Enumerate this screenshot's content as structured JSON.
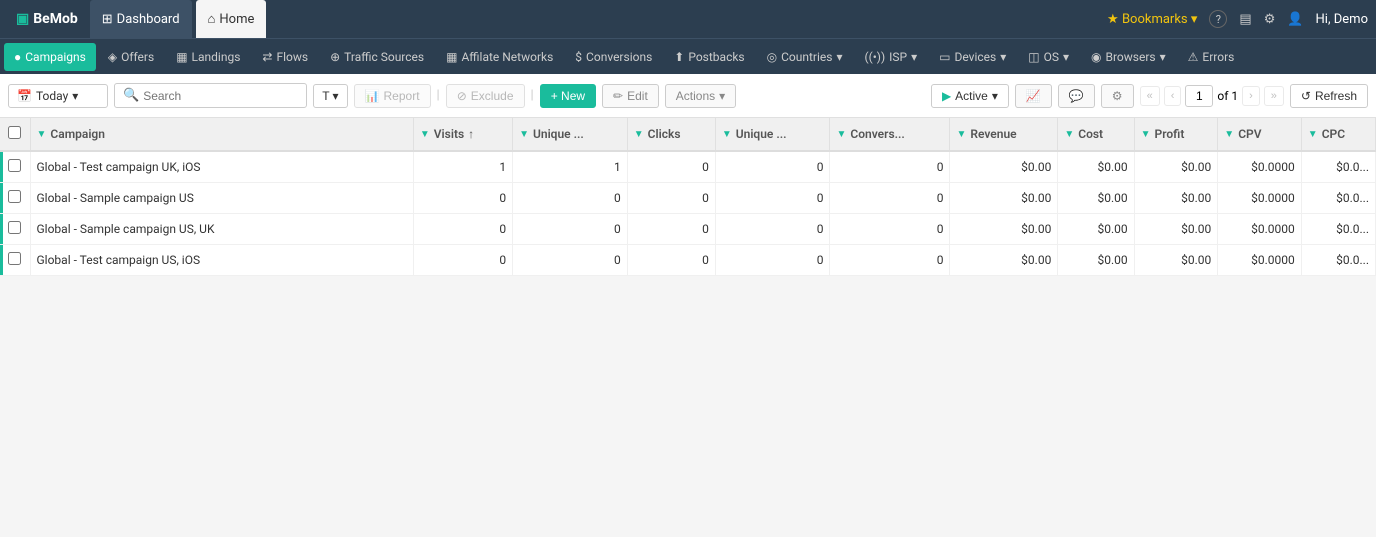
{
  "app": {
    "logo_text": "BeMob",
    "logo_icon": "▣"
  },
  "top_nav": {
    "tabs": [
      {
        "id": "dashboard",
        "label": "Dashboard",
        "icon": "⊞",
        "active": false
      },
      {
        "id": "home",
        "label": "Home",
        "icon": "⌂",
        "active": true
      }
    ],
    "right": {
      "bookmarks_label": "Bookmarks",
      "help_icon": "?",
      "user_greeting": "Hi, Demo"
    }
  },
  "sub_nav": {
    "items": [
      {
        "id": "campaigns",
        "label": "Campaigns",
        "icon": "●",
        "active": true
      },
      {
        "id": "offers",
        "label": "Offers",
        "icon": "◈"
      },
      {
        "id": "landings",
        "label": "Landings",
        "icon": "▦"
      },
      {
        "id": "flows",
        "label": "Flows",
        "icon": "⇄"
      },
      {
        "id": "traffic_sources",
        "label": "Traffic Sources",
        "icon": "⊕"
      },
      {
        "id": "affiliate_networks",
        "label": "Affilate Networks",
        "icon": "▦"
      },
      {
        "id": "conversions",
        "label": "Conversions",
        "icon": "$"
      },
      {
        "id": "postbacks",
        "label": "Postbacks",
        "icon": "⬆"
      },
      {
        "id": "countries",
        "label": "Countries",
        "icon": "◎",
        "has_arrow": true
      },
      {
        "id": "isp",
        "label": "ISP",
        "icon": "((•))",
        "has_arrow": true
      },
      {
        "id": "devices",
        "label": "Devices",
        "icon": "▭",
        "has_arrow": true
      },
      {
        "id": "os",
        "label": "OS",
        "icon": "◫",
        "has_arrow": true
      },
      {
        "id": "browsers",
        "label": "Browsers",
        "icon": "◉",
        "has_arrow": true
      },
      {
        "id": "errors",
        "label": "Errors",
        "icon": "⚠"
      }
    ]
  },
  "toolbar": {
    "date_label": "Today",
    "date_icon": "📅",
    "search_placeholder": "Search",
    "filter_label": "T",
    "report_label": "Report",
    "exclude_label": "Exclude",
    "new_label": "+ New",
    "edit_label": "Edit",
    "actions_label": "Actions",
    "active_label": "Active",
    "pagination": {
      "current_page": "1",
      "total_pages": "of 1"
    },
    "refresh_label": "Refresh"
  },
  "table": {
    "columns": [
      {
        "id": "checkbox",
        "label": ""
      },
      {
        "id": "campaign",
        "label": "Campaign",
        "sortable": true
      },
      {
        "id": "visits",
        "label": "Visits",
        "sortable": true
      },
      {
        "id": "unique_visits",
        "label": "Unique ...",
        "sortable": true
      },
      {
        "id": "clicks",
        "label": "Clicks",
        "sortable": true
      },
      {
        "id": "unique_clicks",
        "label": "Unique ...",
        "sortable": true
      },
      {
        "id": "conversions",
        "label": "Convers...",
        "sortable": true
      },
      {
        "id": "revenue",
        "label": "Revenue",
        "sortable": true
      },
      {
        "id": "cost",
        "label": "Cost",
        "sortable": true
      },
      {
        "id": "profit",
        "label": "Profit",
        "sortable": true
      },
      {
        "id": "cpv",
        "label": "CPV",
        "sortable": true
      },
      {
        "id": "cpc",
        "label": "CPC",
        "sortable": true
      }
    ],
    "rows": [
      {
        "id": 1,
        "campaign": "Global - Test campaign UK, iOS",
        "visits": "1",
        "unique_visits": "1",
        "clicks": "0",
        "unique_clicks": "0",
        "conversions": "0",
        "revenue": "$0.00",
        "cost": "$0.00",
        "profit": "$0.00",
        "cpv": "$0.0000",
        "cpc": "$0.0..."
      },
      {
        "id": 2,
        "campaign": "Global - Sample campaign US",
        "visits": "0",
        "unique_visits": "0",
        "clicks": "0",
        "unique_clicks": "0",
        "conversions": "0",
        "revenue": "$0.00",
        "cost": "$0.00",
        "profit": "$0.00",
        "cpv": "$0.0000",
        "cpc": "$0.0..."
      },
      {
        "id": 3,
        "campaign": "Global - Sample campaign US, UK",
        "visits": "0",
        "unique_visits": "0",
        "clicks": "0",
        "unique_clicks": "0",
        "conversions": "0",
        "revenue": "$0.00",
        "cost": "$0.00",
        "profit": "$0.00",
        "cpv": "$0.0000",
        "cpc": "$0.0..."
      },
      {
        "id": 4,
        "campaign": "Global - Test campaign US, iOS",
        "visits": "0",
        "unique_visits": "0",
        "clicks": "0",
        "unique_clicks": "0",
        "conversions": "0",
        "revenue": "$0.00",
        "cost": "$0.00",
        "profit": "$0.00",
        "cpv": "$0.0000",
        "cpc": "$0.0..."
      }
    ]
  }
}
